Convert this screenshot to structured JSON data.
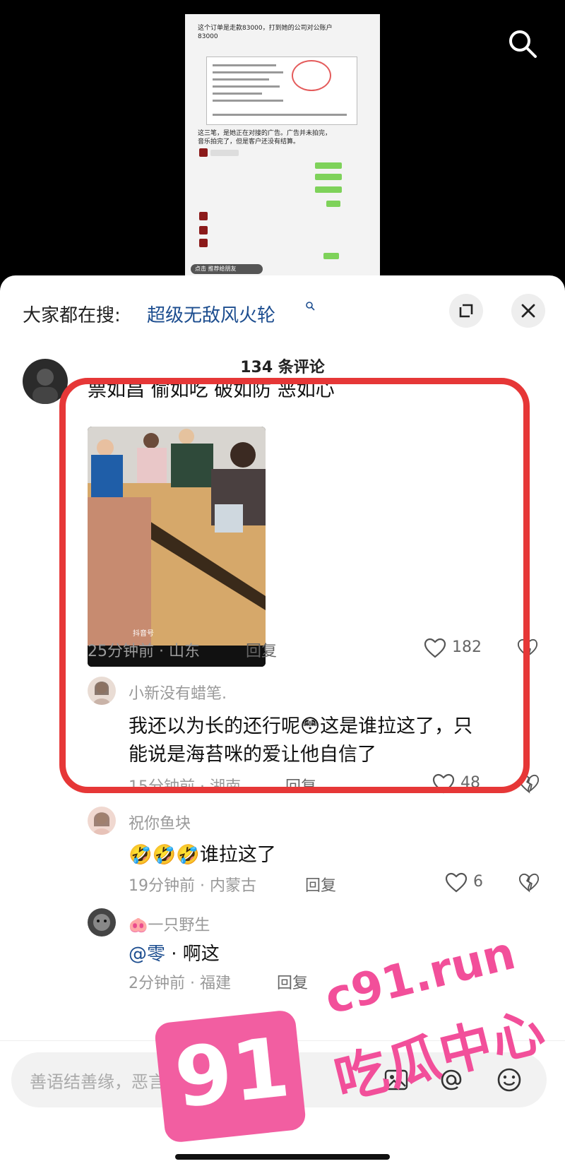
{
  "video": {
    "caption_line1": "这个订单是走款83000，打到她的公司对公账户",
    "caption_line2": "83000",
    "caption_line3": "这三笔，是她正在对接的广告。广告并未拍完，",
    "caption_line4": "音乐拍完了，但是客户还没有结算。",
    "thumb_bar_label": "点击 推荐给朋友"
  },
  "sheet": {
    "trending_prefix": "大家都在搜:",
    "trending_query": "超级无敌风火轮",
    "comment_count": "134 条评论"
  },
  "comments": [
    {
      "text": "票如昌 偷如吃 破如防 恶如心",
      "meta": "25分钟前 · 山东",
      "reply": "回复",
      "likes": "182"
    },
    {
      "username": "小新没有蜡笔.",
      "text_line1": "我还以为长的还行呢😳这是谁拉这了，只",
      "text_line2": "能说是海苔咪的爱让他自信了",
      "meta": "15分钟前 · 湖南",
      "reply": "回复",
      "likes": "48"
    },
    {
      "username": "祝你鱼块",
      "text": "🤣🤣🤣谁拉这了",
      "meta": "19分钟前 · 内蒙古",
      "reply": "回复",
      "likes": "6"
    },
    {
      "username": "🐽一只野生",
      "mention": "@零",
      "text": " · 啊这",
      "meta": "2分钟前 · 福建",
      "reply": "回复"
    }
  ],
  "input": {
    "placeholder": "善语结善缘，恶言伤人心"
  },
  "watermark": {
    "number": "91",
    "url": "c91.run",
    "title": "吃瓜中心"
  },
  "colors": {
    "highlight_frame": "#e63737",
    "link_blue": "#1c4d8f",
    "watermark_pink": "#f24f9a"
  }
}
